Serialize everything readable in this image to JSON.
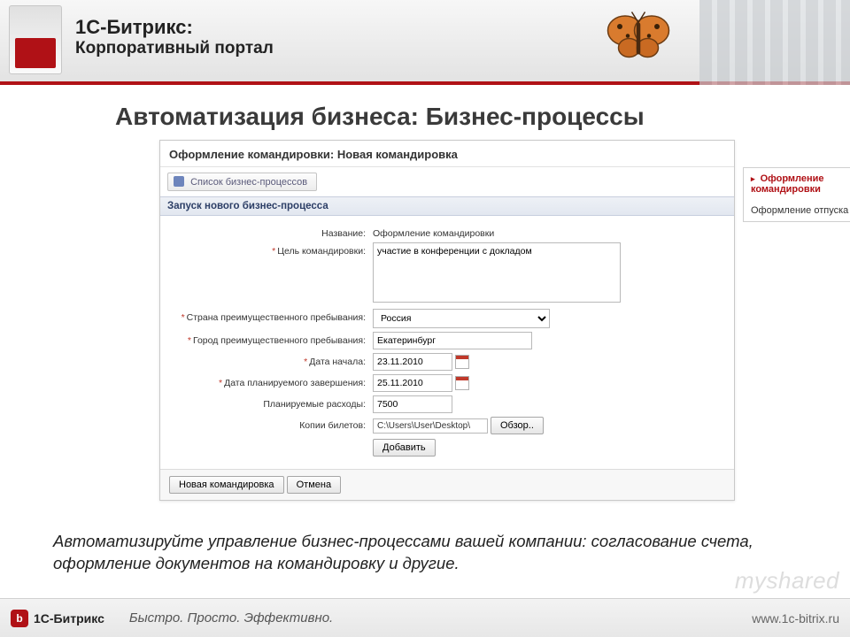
{
  "header": {
    "brand_line1": "1С-Битрикс:",
    "brand_line2": "Корпоративный портал"
  },
  "slide_title": "Автоматизация бизнеса: Бизнес-процессы",
  "screenshot": {
    "window_title": "Оформление командировки: Новая командировка",
    "list_button": "Список бизнес-процессов",
    "sidebar": {
      "items": [
        {
          "label": "Оформление командировки",
          "active": true
        },
        {
          "label": "Оформление отпуска",
          "active": false
        }
      ]
    },
    "section_title": "Запуск нового бизнес-процесса",
    "form": {
      "name_label": "Название:",
      "name_value": "Оформление командировки",
      "goal_label": "Цель командировки:",
      "goal_value": "участие в конференции с докладом",
      "country_label": "Страна преимущественного пребывания:",
      "country_value": "Россия",
      "city_label": "Город преимущественного пребывания:",
      "city_value": "Екатеринбург",
      "start_label": "Дата начала:",
      "start_value": "23.11.2010",
      "end_label": "Дата планируемого завершения:",
      "end_value": "25.11.2010",
      "expenses_label": "Планируемые расходы:",
      "expenses_value": "7500",
      "tickets_label": "Копии билетов:",
      "file_path": "C:\\Users\\User\\Desktop\\",
      "browse_btn": "Обзор..",
      "add_btn": "Добавить"
    },
    "footer_buttons": {
      "submit": "Новая командировка",
      "cancel": "Отмена"
    }
  },
  "caption": "Автоматизируйте управление бизнес-процессами вашей компании: согласование счета, оформление документов на командировку  и другие.",
  "page_footer": {
    "logo_letter": "b",
    "brand": "1С-Битрикс",
    "tagline": "Быстро. Просто. Эффективно.",
    "site": "www.1c-bitrix.ru"
  },
  "watermark": "myshared"
}
